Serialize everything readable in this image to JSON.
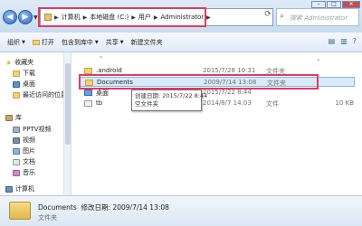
{
  "address": {
    "segments": [
      "计算机",
      "本地磁盘 (C:)",
      "用户",
      "Administrator"
    ],
    "search_placeholder": "搜索 Administrator"
  },
  "toolbar": {
    "items": [
      "组织",
      "打开",
      "包含到库中",
      "共享",
      "新建文件夹"
    ]
  },
  "sidebar": {
    "items": [
      {
        "label": "收藏夹",
        "icon": "star-icon"
      },
      {
        "label": "下载",
        "icon": "download-folder-icon"
      },
      {
        "label": "桌面",
        "icon": "desktop-icon"
      },
      {
        "label": "最近访问的位置",
        "icon": "recent-places-icon"
      },
      {
        "label": "库",
        "icon": "libraries-icon"
      },
      {
        "label": "PPTV视频",
        "icon": "pptv-icon"
      },
      {
        "label": "视频",
        "icon": "video-icon"
      },
      {
        "label": "图片",
        "icon": "pictures-icon"
      },
      {
        "label": "文档",
        "icon": "documents-icon"
      },
      {
        "label": "音乐",
        "icon": "music-icon"
      },
      {
        "label": "计算机",
        "icon": "computer-icon"
      }
    ]
  },
  "files": [
    {
      "name": ".android",
      "date": "2015/7/28 10:31",
      "type": "文件夹",
      "size": ""
    },
    {
      "name": "Documents",
      "date": "2009/7/14 13:08",
      "type": "文件夹",
      "size": ""
    },
    {
      "name": "桌面",
      "date": "2015/7/22 8:44",
      "type": "",
      "size": ""
    },
    {
      "name": "tb",
      "date": "2014/8/7 14:03",
      "type": "文件",
      "size": "10 KB"
    }
  ],
  "tooltip": {
    "line1": "创建日期: 2015/7/22 8:44",
    "line2": "空文件夹"
  },
  "details": {
    "name": "Documents",
    "date_label": "修改日期: 2009/7/14 13:08",
    "type": "文件夹"
  },
  "colors": {
    "highlight": "#e23b5c",
    "selection": "#d9ebfb",
    "folder": "#f1d27a"
  }
}
